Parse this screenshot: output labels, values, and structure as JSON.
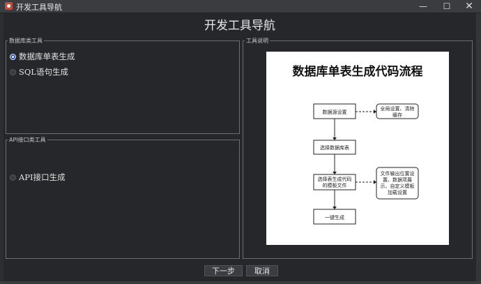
{
  "window": {
    "title": "开发工具导航",
    "minimize": "—",
    "maximize": "☐",
    "close": "✕"
  },
  "page": {
    "title": "开发工具导航"
  },
  "db_group": {
    "legend": "数据库类工具",
    "options": [
      {
        "label": "数据库单表生成",
        "selected": true
      },
      {
        "label": "SQL语句生成",
        "selected": false
      }
    ]
  },
  "api_group": {
    "legend": "API接口类工具",
    "options": [
      {
        "label": "API接口生成",
        "selected": false
      }
    ]
  },
  "desc_group": {
    "legend": "工具说明",
    "diagram": {
      "title": "数据库单表生成代码流程",
      "steps": [
        "数据源设置",
        "选择数据库表",
        "选择表生成代码",
        "的模板文件",
        "一键生成"
      ],
      "notes": [
        "全局设置、清除",
        "缓存",
        "文件输出位置设",
        "置、数据项展",
        "示、自定义模板",
        "加载设置"
      ]
    }
  },
  "buttons": {
    "next": "下一步",
    "cancel": "取消"
  },
  "colors": {
    "background": "#25272b",
    "accent_radio": "#2a58c9",
    "diagram_bg": "#ffffff"
  }
}
